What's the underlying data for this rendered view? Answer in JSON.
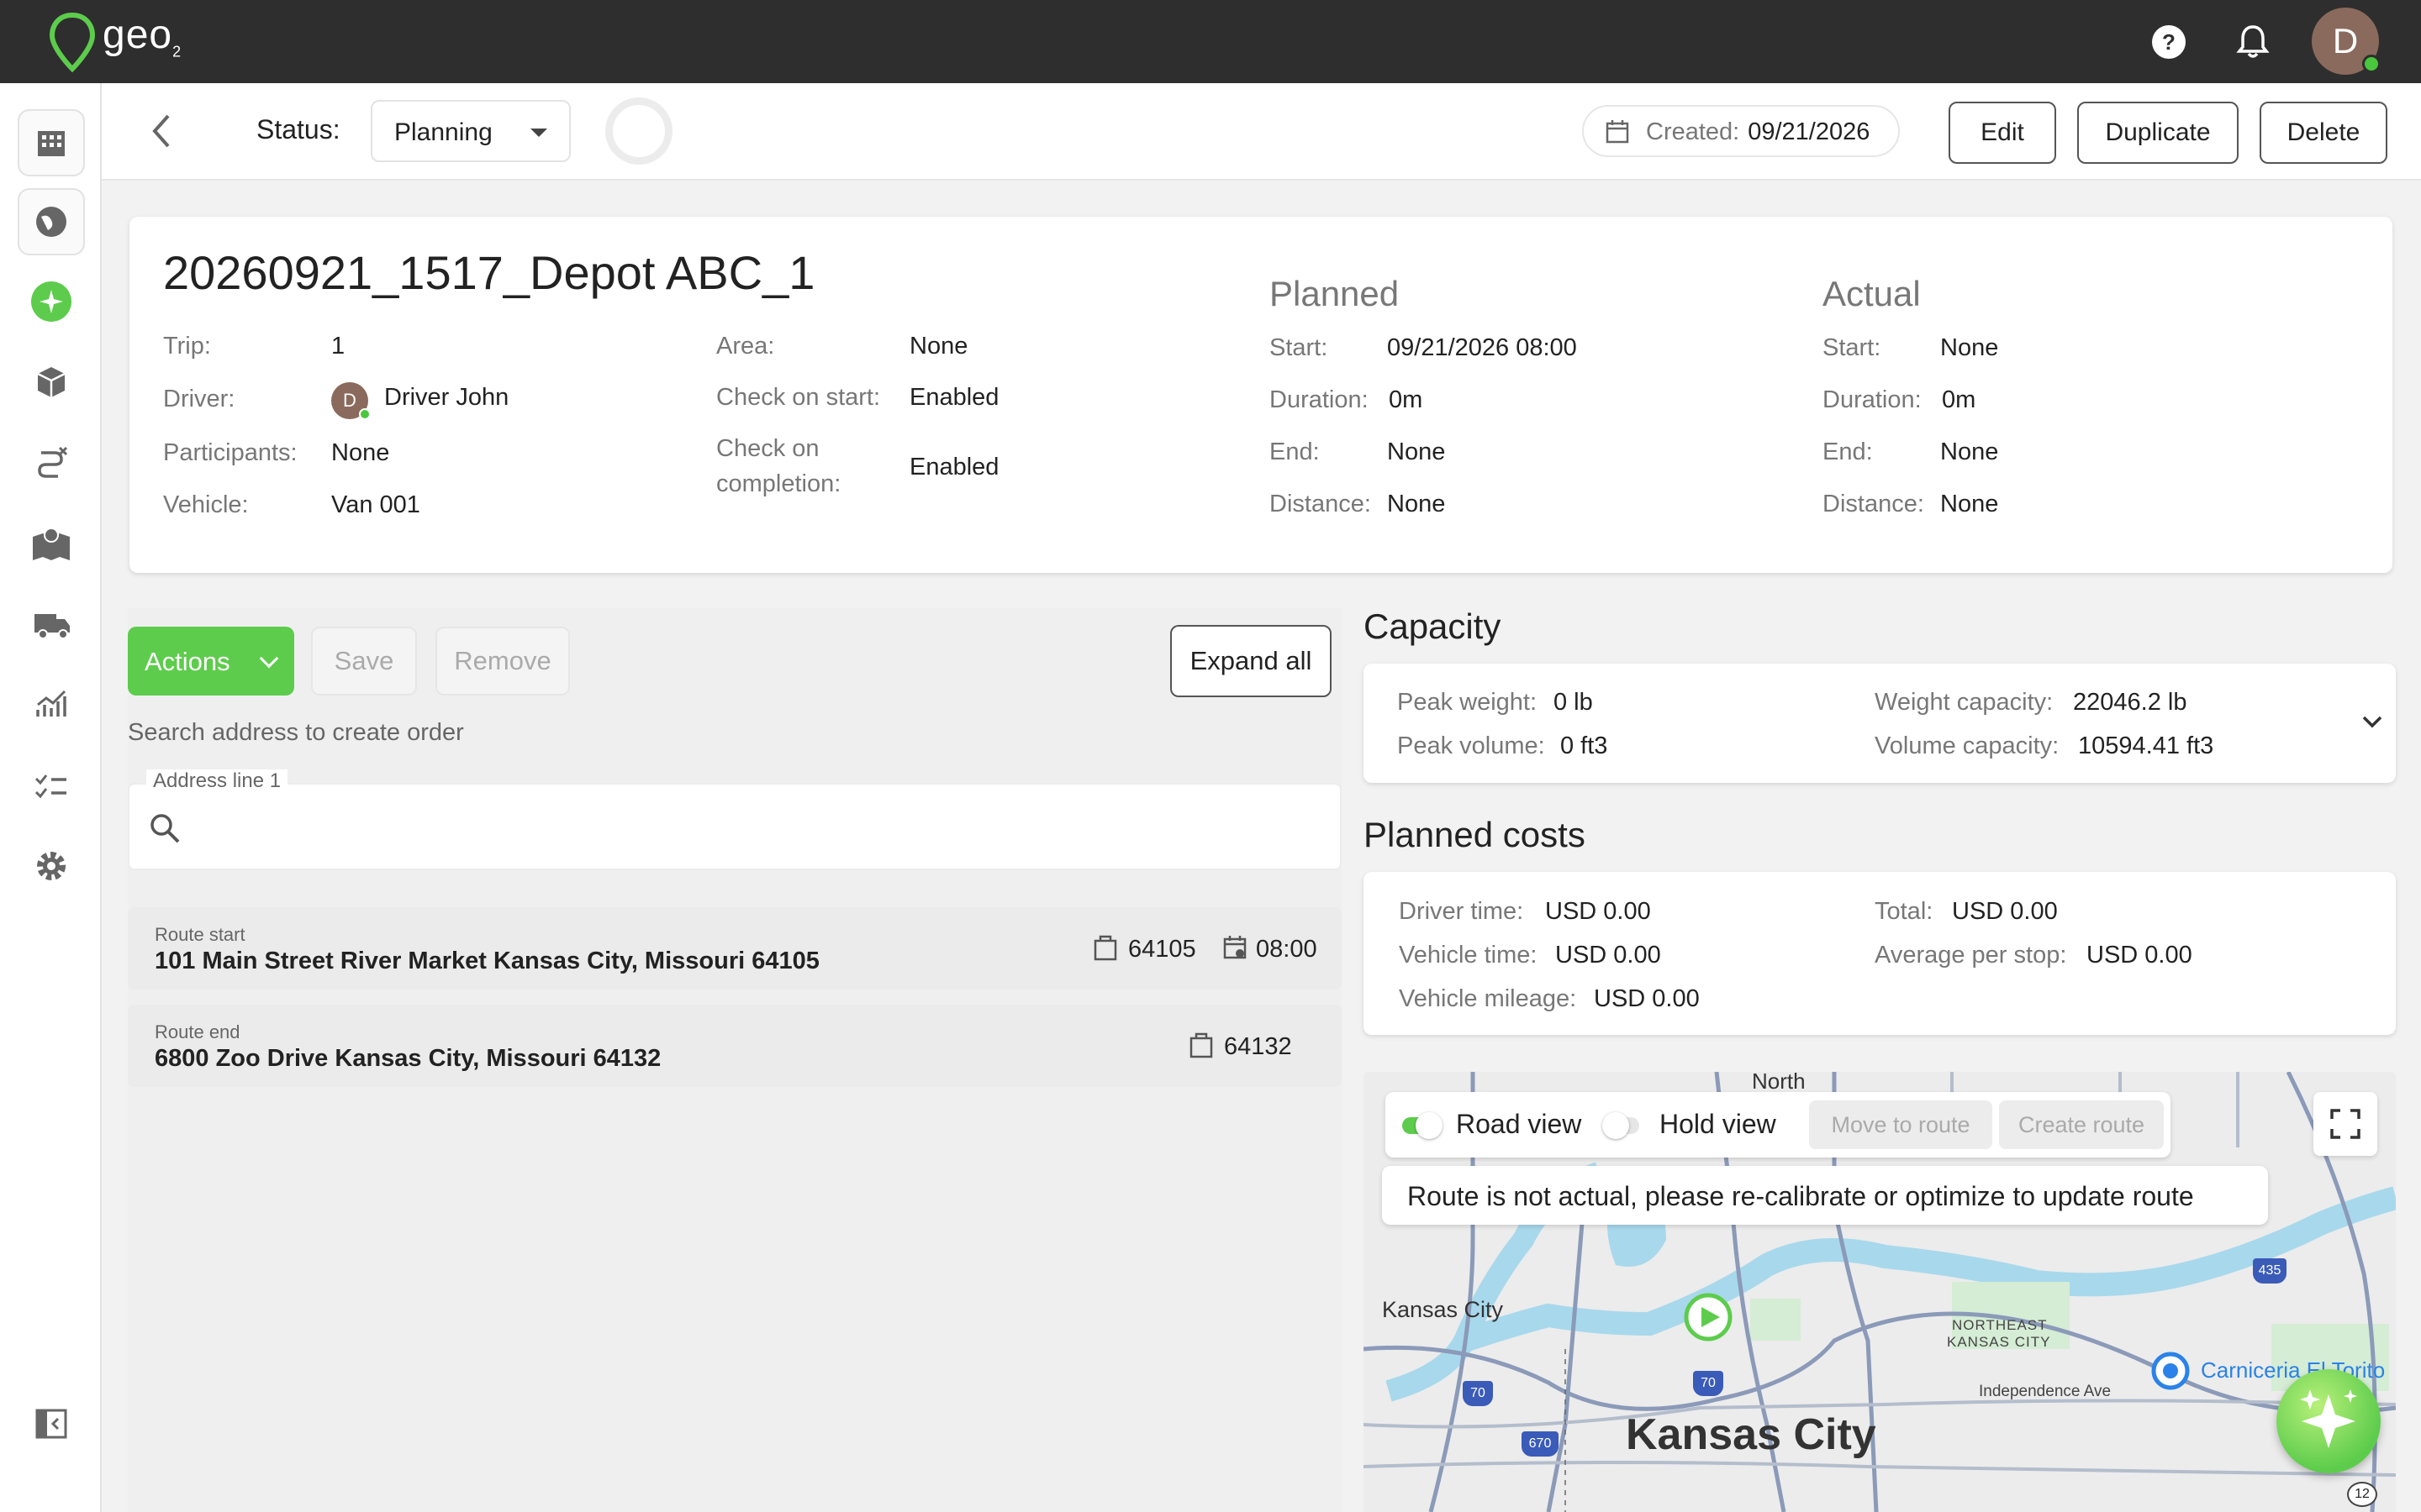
{
  "app": {
    "logo_text": "geo",
    "logo_sub": "2",
    "user_initial": "D"
  },
  "toolbar": {
    "status_label": "Status:",
    "status_value": "Planning",
    "created_label": "Created:",
    "created_value": "09/21/2026",
    "edit_label": "Edit",
    "duplicate_label": "Duplicate",
    "delete_label": "Delete"
  },
  "trip": {
    "title": "20260921_1517_Depot ABC_1",
    "trip_label": "Trip:",
    "trip_value": "1",
    "driver_label": "Driver:",
    "driver_initial": "D",
    "driver_value": "Driver John",
    "participants_label": "Participants:",
    "participants_value": "None",
    "vehicle_label": "Vehicle:",
    "vehicle_value": "Van 001",
    "area_label": "Area:",
    "area_value": "None",
    "check_start_label": "Check on start:",
    "check_start_value": "Enabled",
    "check_completion_label_1": "Check on",
    "check_completion_label_2": "completion:",
    "check_completion_value": "Enabled"
  },
  "planned": {
    "heading": "Planned",
    "start_label": "Start:",
    "start_value": "09/21/2026 08:00",
    "duration_label": "Duration:",
    "duration_value": "0m",
    "end_label": "End:",
    "end_value": "None",
    "distance_label": "Distance:",
    "distance_value": "None"
  },
  "actual": {
    "heading": "Actual",
    "start_label": "Start:",
    "start_value": "None",
    "duration_label": "Duration:",
    "duration_value": "0m",
    "end_label": "End:",
    "end_value": "None",
    "distance_label": "Distance:",
    "distance_value": "None"
  },
  "orders": {
    "actions_label": "Actions",
    "save_label": "Save",
    "remove_label": "Remove",
    "expand_label": "Expand all",
    "search_hint": "Search address to create order",
    "address_label": "Address line 1",
    "address_value": ""
  },
  "route_start": {
    "sub": "Route start",
    "address": "101 Main Street River Market Kansas City, Missouri 64105",
    "zip": "64105",
    "time": "08:00"
  },
  "route_end": {
    "sub": "Route end",
    "address": "6800 Zoo Drive Kansas City, Missouri 64132",
    "zip": "64132"
  },
  "capacity": {
    "title": "Capacity",
    "peak_weight_label": "Peak weight:",
    "peak_weight_value": "0 lb",
    "peak_volume_label": "Peak volume:",
    "peak_volume_value": "0 ft3",
    "weight_capacity_label": "Weight capacity:",
    "weight_capacity_value": "22046.2 lb",
    "volume_capacity_label": "Volume capacity:",
    "volume_capacity_value": "10594.41 ft3"
  },
  "costs": {
    "title": "Planned costs",
    "driver_time_label": "Driver time:",
    "driver_time_value": "USD 0.00",
    "vehicle_time_label": "Vehicle time:",
    "vehicle_time_value": "USD 0.00",
    "vehicle_mileage_label": "Vehicle mileage:",
    "vehicle_mileage_value": "USD 0.00",
    "total_label": "Total:",
    "total_value": "USD 0.00",
    "avg_label": "Average per stop:",
    "avg_value": "USD 0.00"
  },
  "map": {
    "road_view_label": "Road view",
    "road_view_on": true,
    "hold_view_label": "Hold view",
    "hold_view_on": false,
    "move_to_route_label": "Move to route",
    "create_route_label": "Create route",
    "notice": "Route is not actual, please re-calibrate or optimize to update route",
    "labels": {
      "north": "North",
      "kc_small": "Kansas City",
      "kc_big": "Kansas City",
      "ne1": "NORTHEAST",
      "ne2": "KANSAS CITY",
      "street": "Independence Ave",
      "poi": "Carniceria El Torito"
    },
    "shields": {
      "i435": "435",
      "i70a": "70",
      "i70b": "70",
      "i670": "670",
      "r12": "12"
    }
  },
  "colors": {
    "accent": "#5dcc4c",
    "topbar": "#2e2e2e"
  }
}
